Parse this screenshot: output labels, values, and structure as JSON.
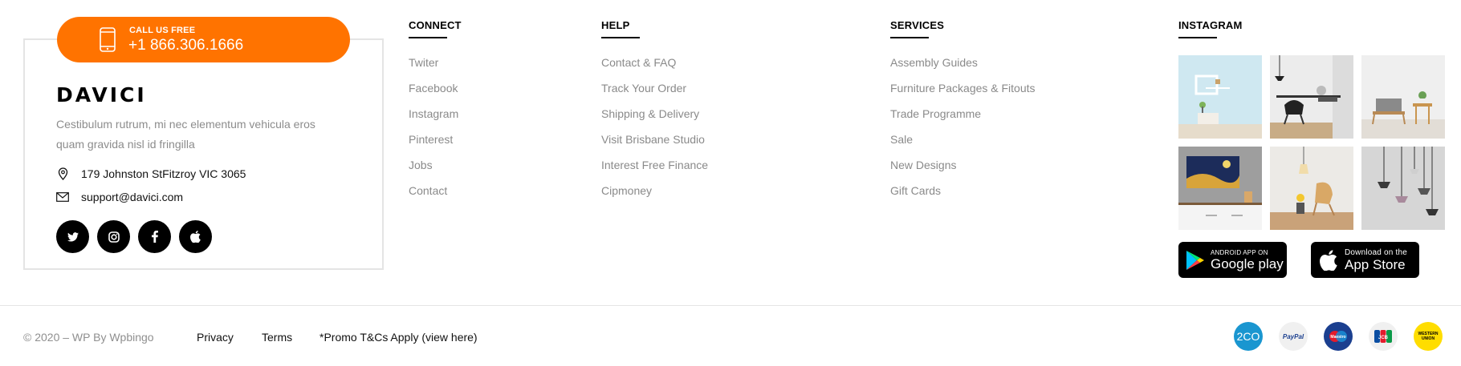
{
  "contact": {
    "call_label": "CALL US FREE",
    "phone": "+1 866.306.1666",
    "logo": "DAVICI",
    "description": "Cestibulum rutrum, mi nec elementum vehicula eros quam gravida nisl id fringilla",
    "address": "179 Johnston StFitzroy VIC 3065",
    "email": "support@davici.com",
    "socials": [
      "twitter-icon",
      "instagram-icon",
      "facebook-icon",
      "apple-icon"
    ]
  },
  "columns": {
    "connect": {
      "title": "CONNECT",
      "items": [
        "Twiter",
        "Facebook",
        "Instagram",
        "Pinterest",
        "Jobs",
        "Contact"
      ]
    },
    "help": {
      "title": "HELP",
      "items": [
        "Contact & FAQ",
        "Track Your Order",
        "Shipping & Delivery",
        "Visit Brisbane Studio",
        "Interest Free Finance",
        "Cipmoney"
      ]
    },
    "services": {
      "title": "SERVICES",
      "items": [
        "Assembly Guides",
        "Furniture Packages & Fitouts",
        "Trade Programme",
        "Sale",
        "New Designs",
        "Gift Cards"
      ]
    }
  },
  "instagram": {
    "title": "INSTAGRAM",
    "google_play": {
      "small": "ANDROID APP ON",
      "large": "Google play"
    },
    "app_store": {
      "small": "Download on the",
      "large": "App Store"
    }
  },
  "bottom": {
    "copyright": "© 2020 – WP By Wpbingo",
    "links": [
      "Privacy",
      "Terms",
      "*Promo T&Cs Apply (view here)"
    ],
    "payments": [
      "2CO",
      "PayPal",
      "Maestro",
      "JCB",
      "WESTERN UNION"
    ]
  },
  "colors": {
    "accent": "#ff7300",
    "muted_text": "#8a8a8a",
    "border": "#e4e4e4"
  }
}
